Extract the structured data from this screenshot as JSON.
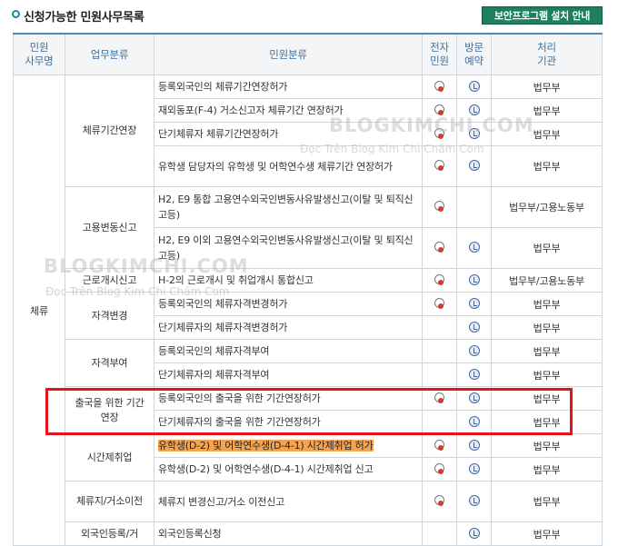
{
  "header": {
    "title": "신청가능한 민원사무목록",
    "security_button": "보안프로그램 설치 안내"
  },
  "table": {
    "headers": [
      "민원\n사무명",
      "업무분류",
      "민원분류",
      "전자\n민원",
      "방문\n예약",
      "처리\n기관"
    ],
    "office": "체류",
    "groups": [
      {
        "category": "체류기간연장",
        "rows": [
          {
            "name": "등록외국인의 체류기간연장허가",
            "e": true,
            "v": true,
            "agency": "법무부"
          },
          {
            "name": "재외동포(F-4) 거소신고자 체류기간 연장허가",
            "e": true,
            "v": true,
            "agency": "법무부"
          },
          {
            "name": "단기체류자 체류기간연장허가",
            "e": true,
            "v": true,
            "agency": "법무부"
          },
          {
            "name": "유학생 담당자의 유학생 및 어학연수생 체류기간 연장허가",
            "e": true,
            "v": true,
            "agency": "법무부",
            "tall": true
          }
        ]
      },
      {
        "category": "고용변동신고",
        "rows": [
          {
            "name": "H2, E9 통합 고용연수외국인변동사유발생신고(이탈 및 퇴직신고등)",
            "e": true,
            "v": false,
            "agency": "법무부/고용노동부",
            "tall": true
          },
          {
            "name": "H2, E9 이외 고용연수외국인변동사유발생신고(이탈 및 퇴직신고등)",
            "e": true,
            "v": true,
            "agency": "법무부",
            "tall": true
          }
        ]
      },
      {
        "category": "근로개시신고",
        "rows": [
          {
            "name": "H-2의 근로개시 및 취업개시 통합신고",
            "e": true,
            "v": true,
            "agency": "법무부/고용노동부"
          }
        ]
      },
      {
        "category": "자격변경",
        "rows": [
          {
            "name": "등록외국인의 체류자격변경허가",
            "e": true,
            "v": true,
            "agency": "법무부"
          },
          {
            "name": "단기체류자의 체류자격변경허가",
            "e": false,
            "v": true,
            "agency": "법무부"
          }
        ]
      },
      {
        "category": "자격부여",
        "rows": [
          {
            "name": "등록외국인의 체류자격부여",
            "e": false,
            "v": true,
            "agency": "법무부"
          },
          {
            "name": "단기체류자의 체류자격부여",
            "e": false,
            "v": true,
            "agency": "법무부"
          }
        ]
      },
      {
        "category": "출국을 위한 기간연장",
        "rows": [
          {
            "name": "등록외국인의 출국을 위한 기간연장허가",
            "e": true,
            "v": true,
            "agency": "법무부"
          },
          {
            "name": "단기체류자의 출국을 위한 기간연장허가",
            "e": false,
            "v": true,
            "agency": "법무부"
          }
        ]
      },
      {
        "category": "시간제취업",
        "rows": [
          {
            "name": "유학생(D-2) 및 어학연수생(D-4-1) 시간제취업 허가",
            "e": true,
            "v": true,
            "agency": "법무부",
            "highlight": true
          },
          {
            "name": "유학생(D-2) 및 어학연수생(D-4-1) 시간제취업 신고",
            "e": true,
            "v": true,
            "agency": "법무부"
          }
        ]
      },
      {
        "category": "체류지/거소이전",
        "rows": [
          {
            "name": "체류지 변경신고/거소 이전신고",
            "e": true,
            "v": true,
            "agency": "법무부",
            "tall": true
          }
        ]
      },
      {
        "category": "외국인등록/거",
        "rows": [
          {
            "name": "외국인등록신청",
            "e": false,
            "v": true,
            "agency": "법무부"
          }
        ]
      }
    ]
  },
  "watermark": {
    "brand": "BLOGKIMCHI.COM",
    "tagline": "Đọc Trên Blog Kim Chi Chấm Com"
  },
  "colors": {
    "header_text": "#3f6fa3",
    "header_rule": "#5a86b5",
    "button_bg": "#1d7f5f",
    "highlight": "#f5a34f",
    "annotation_box": "#e3141a"
  },
  "icons": {
    "e_civil": "e-civil-apply-icon",
    "visit": "visit-reservation-icon"
  }
}
